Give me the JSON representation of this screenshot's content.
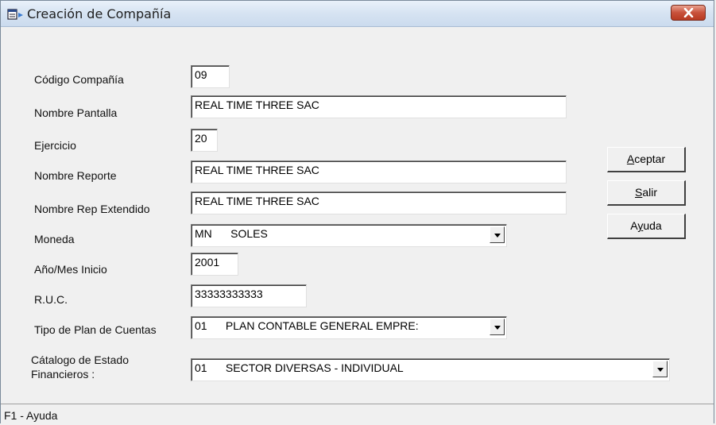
{
  "window": {
    "title": "Creación de Compañía",
    "status": "F1 - Ayuda"
  },
  "form": {
    "codigo": {
      "label": "Código Compañía",
      "value": "09"
    },
    "nombre_pantalla": {
      "label": "Nombre Pantalla",
      "value": "REAL TIME THREE SAC"
    },
    "ejercicio": {
      "label": "Ejercicio",
      "value": "20"
    },
    "nombre_reporte": {
      "label": "Nombre Reporte",
      "value": "REAL TIME THREE SAC"
    },
    "nombre_rep_ext": {
      "label": "Nombre Rep Extendido",
      "value": "REAL TIME THREE SAC"
    },
    "moneda": {
      "label": "Moneda",
      "value": "MN      SOLES"
    },
    "anio_mes": {
      "label": "Año/Mes Inicio",
      "value": "2001"
    },
    "ruc": {
      "label": "R.U.C.",
      "value": "33333333333"
    },
    "tipo_plan": {
      "label": "Tipo de Plan de Cuentas",
      "value": "01      PLAN CONTABLE GENERAL EMPRE:"
    },
    "catalogo": {
      "label_line1": "Cátalogo de Estado",
      "label_line2": "Financieros :",
      "value": "01      SECTOR DIVERSAS - INDIVIDUAL"
    }
  },
  "buttons": {
    "aceptar": {
      "mnemonic": "A",
      "rest": "ceptar"
    },
    "salir": {
      "mnemonic": "S",
      "rest": "alir"
    },
    "ayuda": {
      "pre": "A",
      "mnemonic": "y",
      "rest": "uda"
    }
  },
  "icons": {
    "window": "form-window-icon",
    "close": "close-icon",
    "dropdown": "chevron-down-icon"
  },
  "colors": {
    "close_button": "#c8513b",
    "titlebar": "#d6e3f2",
    "background": "#f0f0f0"
  }
}
